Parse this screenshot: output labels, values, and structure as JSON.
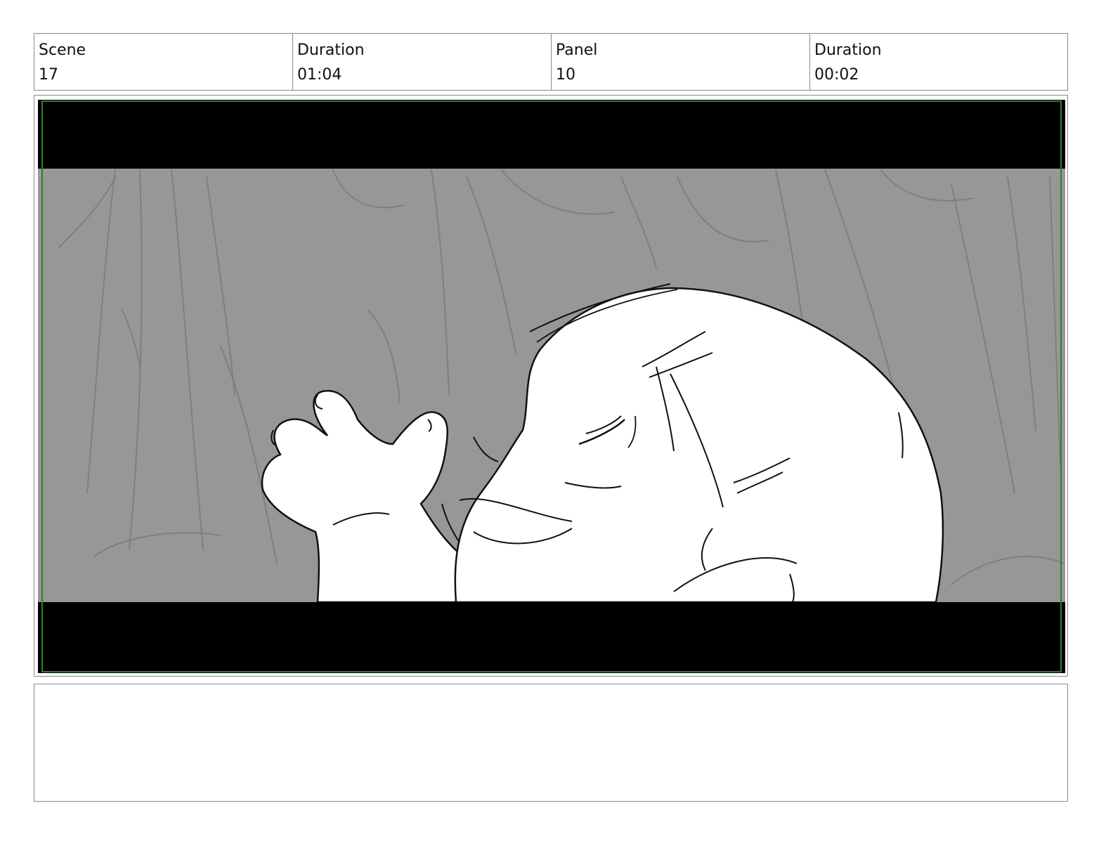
{
  "header": {
    "scene_label": "Scene",
    "scene_value": "17",
    "scene_duration_label": "Duration",
    "scene_duration_value": "01:04",
    "panel_label": "Panel",
    "panel_value": "10",
    "panel_duration_label": "Duration",
    "panel_duration_value": "00:02"
  },
  "panel": {
    "colors": {
      "background": "#979797",
      "letterbox": "#000000",
      "safe_frame": "#2e7d32",
      "trees": "#7f7f7f",
      "ink": "#111111"
    },
    "icons": [
      "storyboard-sketch"
    ]
  },
  "notes": {
    "text": ""
  }
}
